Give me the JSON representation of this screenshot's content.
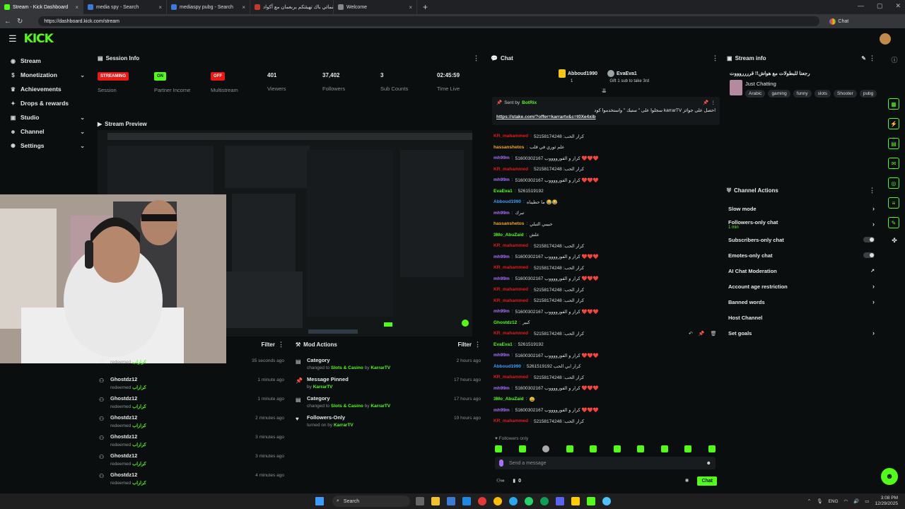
{
  "browser": {
    "tabs": [
      {
        "title": "Stream - Kick Dashboard",
        "active": true,
        "color": "#53fc18"
      },
      {
        "title": "media spy - Search",
        "active": false,
        "color": "#3a7bd5"
      },
      {
        "title": "mediaspy pubg - Search",
        "active": false,
        "color": "#3a7bd5"
      },
      {
        "title": "سينمائي باك تهيئتكم بربعمان مع آكواد",
        "active": false,
        "color": "#c0392b"
      },
      {
        "title": "Welcome",
        "active": false,
        "color": "#888888"
      }
    ],
    "url": "https://dashboard.kick.com/stream",
    "chat_label": "Chat"
  },
  "app": {
    "logo": "KICK",
    "accent": "#53fc18"
  },
  "sidebar": {
    "items": [
      {
        "label": "Stream",
        "icon": "stream-icon",
        "glyph": "◉",
        "chevron": false
      },
      {
        "label": "Monetization",
        "icon": "dollar-icon",
        "glyph": "$",
        "chevron": true
      },
      {
        "label": "Achievements",
        "icon": "trophy-icon",
        "glyph": "♛",
        "chevron": false
      },
      {
        "label": "Drops & rewards",
        "icon": "gift-icon",
        "glyph": "✦",
        "chevron": false
      },
      {
        "label": "Studio",
        "icon": "studio-icon",
        "glyph": "▣",
        "chevron": true
      },
      {
        "label": "Channel",
        "icon": "person-icon",
        "glyph": "☻",
        "chevron": true
      },
      {
        "label": "Settings",
        "icon": "gear-icon",
        "glyph": "✺",
        "chevron": true
      }
    ]
  },
  "session": {
    "title": "Session Info",
    "stats": [
      {
        "value": "STREAMING",
        "label": "Session",
        "kind": "badge-red"
      },
      {
        "value": "ON",
        "label": "Partner Income",
        "kind": "badge-green"
      },
      {
        "value": "OFF",
        "label": "Multistream",
        "kind": "badge-red"
      },
      {
        "value": "401",
        "label": "Viewers",
        "kind": "text"
      },
      {
        "value": "37,402",
        "label": "Followers",
        "kind": "text"
      },
      {
        "value": "3",
        "label": "Sub Counts",
        "kind": "text"
      },
      {
        "value": "02:45:59",
        "label": "Time Live",
        "kind": "text"
      }
    ]
  },
  "preview": {
    "title": "Stream Preview"
  },
  "events": {
    "filter": "Filter",
    "rows": [
      {
        "name": "",
        "action": "redeemed",
        "item": "كراراب",
        "time": "35 seconds ago"
      },
      {
        "name": "Ghostdz12",
        "action": "redeemed",
        "item": "كراراب",
        "time": "1 minute ago"
      },
      {
        "name": "Ghostdz12",
        "action": "redeemed",
        "item": "كراراب",
        "time": "1 minute ago"
      },
      {
        "name": "Ghostdz12",
        "action": "redeemed",
        "item": "كراراب",
        "time": "2 minutes ago"
      },
      {
        "name": "Ghostdz12",
        "action": "redeemed",
        "item": "كراراب",
        "time": "3 minutes ago"
      },
      {
        "name": "Ghostdz12",
        "action": "redeemed",
        "item": "كراراب",
        "time": "3 minutes ago"
      },
      {
        "name": "Ghostdz12",
        "action": "redeemed",
        "item": "كراراب",
        "time": "4 minutes ago"
      }
    ]
  },
  "mod_actions": {
    "title": "Mod Actions",
    "filter": "Filter",
    "rows": [
      {
        "title": "Category",
        "sub": "changed to",
        "target": "Slots & Casino",
        "by": "by",
        "user": "KarrarTV",
        "time": "2 hours ago",
        "icon": "category-icon",
        "glyph": "▤"
      },
      {
        "title": "Message Pinned",
        "sub": "by",
        "target": "KarrarTV",
        "by": "",
        "user": "",
        "time": "17 hours ago",
        "icon": "pin-icon",
        "glyph": "📌"
      },
      {
        "title": "Category",
        "sub": "changed to",
        "target": "Slots & Casino",
        "by": "by",
        "user": "KarrarTV",
        "time": "17 hours ago",
        "icon": "category-icon",
        "glyph": "▤"
      },
      {
        "title": "Followers-Only",
        "sub": "turned on by",
        "target": "KarrarTV",
        "by": "",
        "user": "",
        "time": "19 hours ago",
        "icon": "heart-icon",
        "glyph": "♥"
      }
    ]
  },
  "chat": {
    "title": "Chat",
    "leaders": [
      {
        "name": "Abboud1990",
        "count": "1"
      },
      {
        "name": "EvaEva1",
        "count": "1"
      }
    ],
    "gift_note": "Gift 1 sub to take 3rd",
    "pinned": {
      "sent_by_label": "Sent by",
      "sender": "BotRix",
      "text": "احصل على جوائز karrarTV سجلوا على \" ستيك \" واستخدموا كود",
      "link": "https://stake.com/?offer=karrartv&c=t0Xe4xib"
    },
    "messages": [
      {
        "user": "KR_mahammed",
        "color": "#e91916",
        "text": "52158174248 :كرار الحب"
      },
      {
        "user": "hassanshetos",
        "color": "#f5a623",
        "text": "علم ثوري في قلب"
      },
      {
        "user": "mh99m",
        "color": "#a970ff",
        "text": "كرار و الفورووووب 51600302167 ❤️❤️❤️"
      },
      {
        "user": "KR_mahammed",
        "color": "#e91916",
        "text": "52158174248 :كرار الحب"
      },
      {
        "user": "mh99m",
        "color": "#a970ff",
        "text": "كرار و الفورووووب 51600302167 ❤️❤️❤️"
      },
      {
        "user": "EvaEva1",
        "color": "#53fc18",
        "text": "5261519192"
      },
      {
        "user": "Abboud1990",
        "color": "#3a9cff",
        "text": "ما حطيناه 😂😂"
      },
      {
        "user": "mh99m",
        "color": "#a970ff",
        "text": "تبرك"
      },
      {
        "user": "hassanshetos",
        "color": "#f5a623",
        "text": "حبيبي التبلي"
      },
      {
        "user": "3Mo_AbuZaid",
        "color": "#53fc18",
        "text": "علش"
      },
      {
        "user": "KR_mahammed",
        "color": "#e91916",
        "text": "52158174248 :كرار الحب"
      },
      {
        "user": "mh99m",
        "color": "#a970ff",
        "text": "كرار و الفورووووب 51600302167 ❤️❤️❤️"
      },
      {
        "user": "KR_mahammed",
        "color": "#e91916",
        "text": "52158174248 :كرار الحب"
      },
      {
        "user": "mh99m",
        "color": "#a970ff",
        "text": "كرار و الفورووووب 51600302167 ❤️❤️❤️"
      },
      {
        "user": "KR_mahammed",
        "color": "#e91916",
        "text": "52158174248 :كرار الحب"
      },
      {
        "user": "KR_mahammed",
        "color": "#e91916",
        "text": "52158174248 :كرار الحب"
      },
      {
        "user": "mh99m",
        "color": "#a970ff",
        "text": "كرار و الفورووووب 51600302167 ❤️❤️❤️"
      },
      {
        "user": "Ghostdz12",
        "color": "#53fc18",
        "text": "كبير"
      },
      {
        "user": "KR_mahammed",
        "color": "#e91916",
        "text": "52158174248 :كرار الحب"
      },
      {
        "user": "EvaEva1",
        "color": "#53fc18",
        "text": "5261519192"
      },
      {
        "user": "mh99m",
        "color": "#a970ff",
        "text": "كرار و الفورووووب 51600302167 ❤️❤️❤️"
      },
      {
        "user": "Abboud1990",
        "color": "#3a9cff",
        "text": "كرار ابي الحب 5261519192"
      },
      {
        "user": "KR_mahammed",
        "color": "#e91916",
        "text": "52158174248 :كرار الحب"
      },
      {
        "user": "mh99m",
        "color": "#a970ff",
        "text": "كرار و الفورووووب 51600302167 ❤️❤️❤️"
      },
      {
        "user": "3Mo_AbuZaid",
        "color": "#53fc18",
        "text": "😀"
      },
      {
        "user": "mh99m",
        "color": "#a970ff",
        "text": "كرار و الفورووووب 51600302167 ❤️❤️❤️"
      },
      {
        "user": "KR_mahammed",
        "color": "#e91916",
        "text": "52158174248 :كرار الحب"
      }
    ],
    "followers_only": "Followers only",
    "placeholder": "Send a message",
    "points": "0",
    "send_label": "Chat"
  },
  "stream_info": {
    "title": "Stream info",
    "stream_title": "رجعنا للبطولات مع هواش!! قرررروووت",
    "category": "Just Chatting",
    "tags": [
      "Arabic",
      "gaming",
      "funny",
      "slots",
      "Shooter",
      "pubg"
    ]
  },
  "channel_actions": {
    "title": "Channel Actions",
    "rows": [
      {
        "label": "Slow mode",
        "sub": "",
        "control": "chevron"
      },
      {
        "label": "Followers-only chat",
        "sub": "1 min",
        "control": "chevron"
      },
      {
        "label": "Subscribers-only chat",
        "sub": "",
        "control": "toggle"
      },
      {
        "label": "Emotes-only chat",
        "sub": "",
        "control": "toggle"
      },
      {
        "label": "AI Chat Moderation",
        "sub": "",
        "control": "external"
      },
      {
        "label": "Account age restriction",
        "sub": "",
        "control": "chevron"
      },
      {
        "label": "Banned words",
        "sub": "",
        "control": "chevron"
      },
      {
        "label": "Host Channel",
        "sub": "",
        "control": "none"
      },
      {
        "label": "Set goals",
        "sub": "",
        "control": "chevron"
      }
    ]
  },
  "taskbar": {
    "search_label": "Search",
    "lang": "ENG",
    "time": "3:08 PM",
    "date": "12/29/2025"
  }
}
